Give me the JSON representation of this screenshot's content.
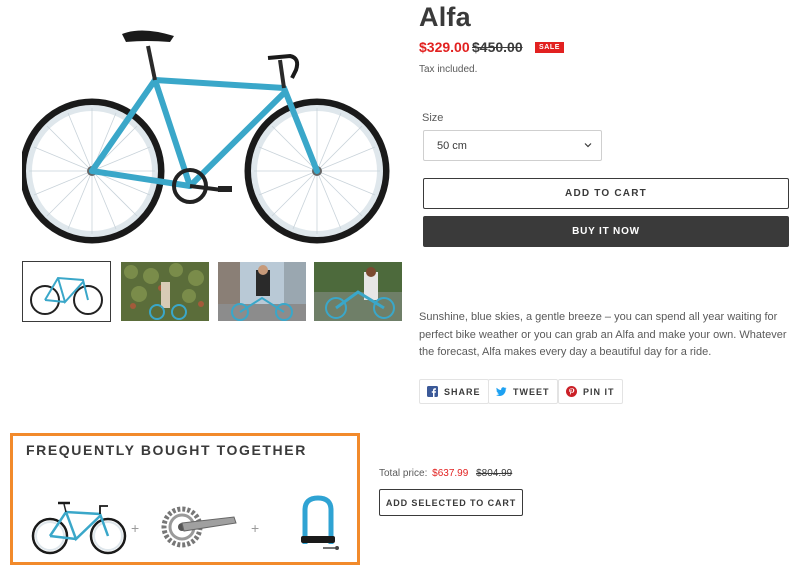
{
  "product": {
    "title": "Alfa",
    "sale_price": "$329.00",
    "compare_price": "$450.00",
    "badge": "SALE",
    "tax_note": "Tax included.",
    "description": "Sunshine, blue skies, a gentle breeze – you can spend all year waiting for perfect bike weather or you can grab an Alfa and make your own. Whatever the forecast, Alfa makes every day a beautiful day for a ride."
  },
  "size": {
    "label": "Size",
    "selected": "50 cm"
  },
  "buttons": {
    "add_to_cart": "ADD TO CART",
    "buy_now": "BUY IT NOW"
  },
  "share": {
    "facebook": "SHARE",
    "twitter": "TWEET",
    "pinterest": "PIN IT"
  },
  "fbt": {
    "title": "FREQUENTLY BOUGHT TOGETHER",
    "plus": "+",
    "items": [
      "bike-image",
      "crankset-image",
      "u-lock-image"
    ],
    "total_label": "Total price:",
    "total_price": "$637.99",
    "total_compare": "$804.99",
    "add_selected": "ADD SELECTED TO CART"
  },
  "thumbnails": [
    "bike-studio-thumbnail",
    "bike-ivy-wall-thumbnail",
    "bike-rider-city-thumbnail",
    "bike-rider-outdoor-thumbnail"
  ],
  "colors": {
    "sale_red": "#e22120",
    "frame_blue": "#3aa7c9",
    "highlight_orange": "#f28a2b",
    "dark": "#3a3a3a"
  }
}
